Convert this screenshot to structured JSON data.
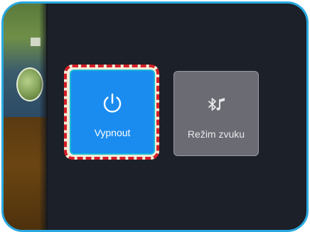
{
  "menu": {
    "items": [
      {
        "label": "Vypnout",
        "icon": "power-icon",
        "selected": true,
        "color": "#1a8cf0"
      },
      {
        "label": "Režim zvuku",
        "icon": "bluetooth-music-icon",
        "selected": false,
        "color": "#6b6b74"
      }
    ],
    "highlight_color": "#d51e26",
    "frame_color": "#29a9e0"
  }
}
